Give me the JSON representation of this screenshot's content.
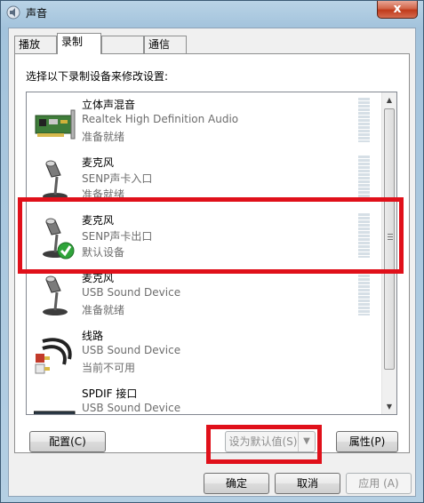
{
  "window": {
    "title": "声音",
    "close_label": "x"
  },
  "tabs": [
    {
      "label": "播放",
      "active": false
    },
    {
      "label": "录制",
      "active": true
    },
    {
      "label": "",
      "active": false
    },
    {
      "label": "通信",
      "active": false
    }
  ],
  "instruction": "选择以下录制设备来修改设置:",
  "devices": [
    {
      "name": "立体声混音",
      "description": "Realtek High Definition Audio",
      "status": "准备就绪",
      "icon": "sound-card-icon"
    },
    {
      "name": "麦克风",
      "description": "SENP声卡入口",
      "status": "准备就绪",
      "icon": "microphone-icon"
    },
    {
      "name": "麦克风",
      "description": "SENP声卡出口",
      "status": "默认设备",
      "icon": "microphone-default-icon",
      "selected": true
    },
    {
      "name": "麦克风",
      "description": "USB Sound Device",
      "status": "准备就绪",
      "icon": "microphone-icon"
    },
    {
      "name": "线路",
      "description": "USB Sound Device",
      "status": "当前不可用",
      "icon": "rca-cable-icon"
    },
    {
      "name": "SPDIF 接口",
      "description": "USB Sound Device",
      "status": "",
      "icon": "spdif-device-icon"
    }
  ],
  "buttons": {
    "configure": "配置(C)",
    "set_default": "设为默认值(S)",
    "properties": "属性(P)",
    "ok": "确定",
    "cancel": "取消",
    "apply": "应用 (A)"
  },
  "colors": {
    "highlight": "#e0101a",
    "selection": "#e0101a"
  }
}
